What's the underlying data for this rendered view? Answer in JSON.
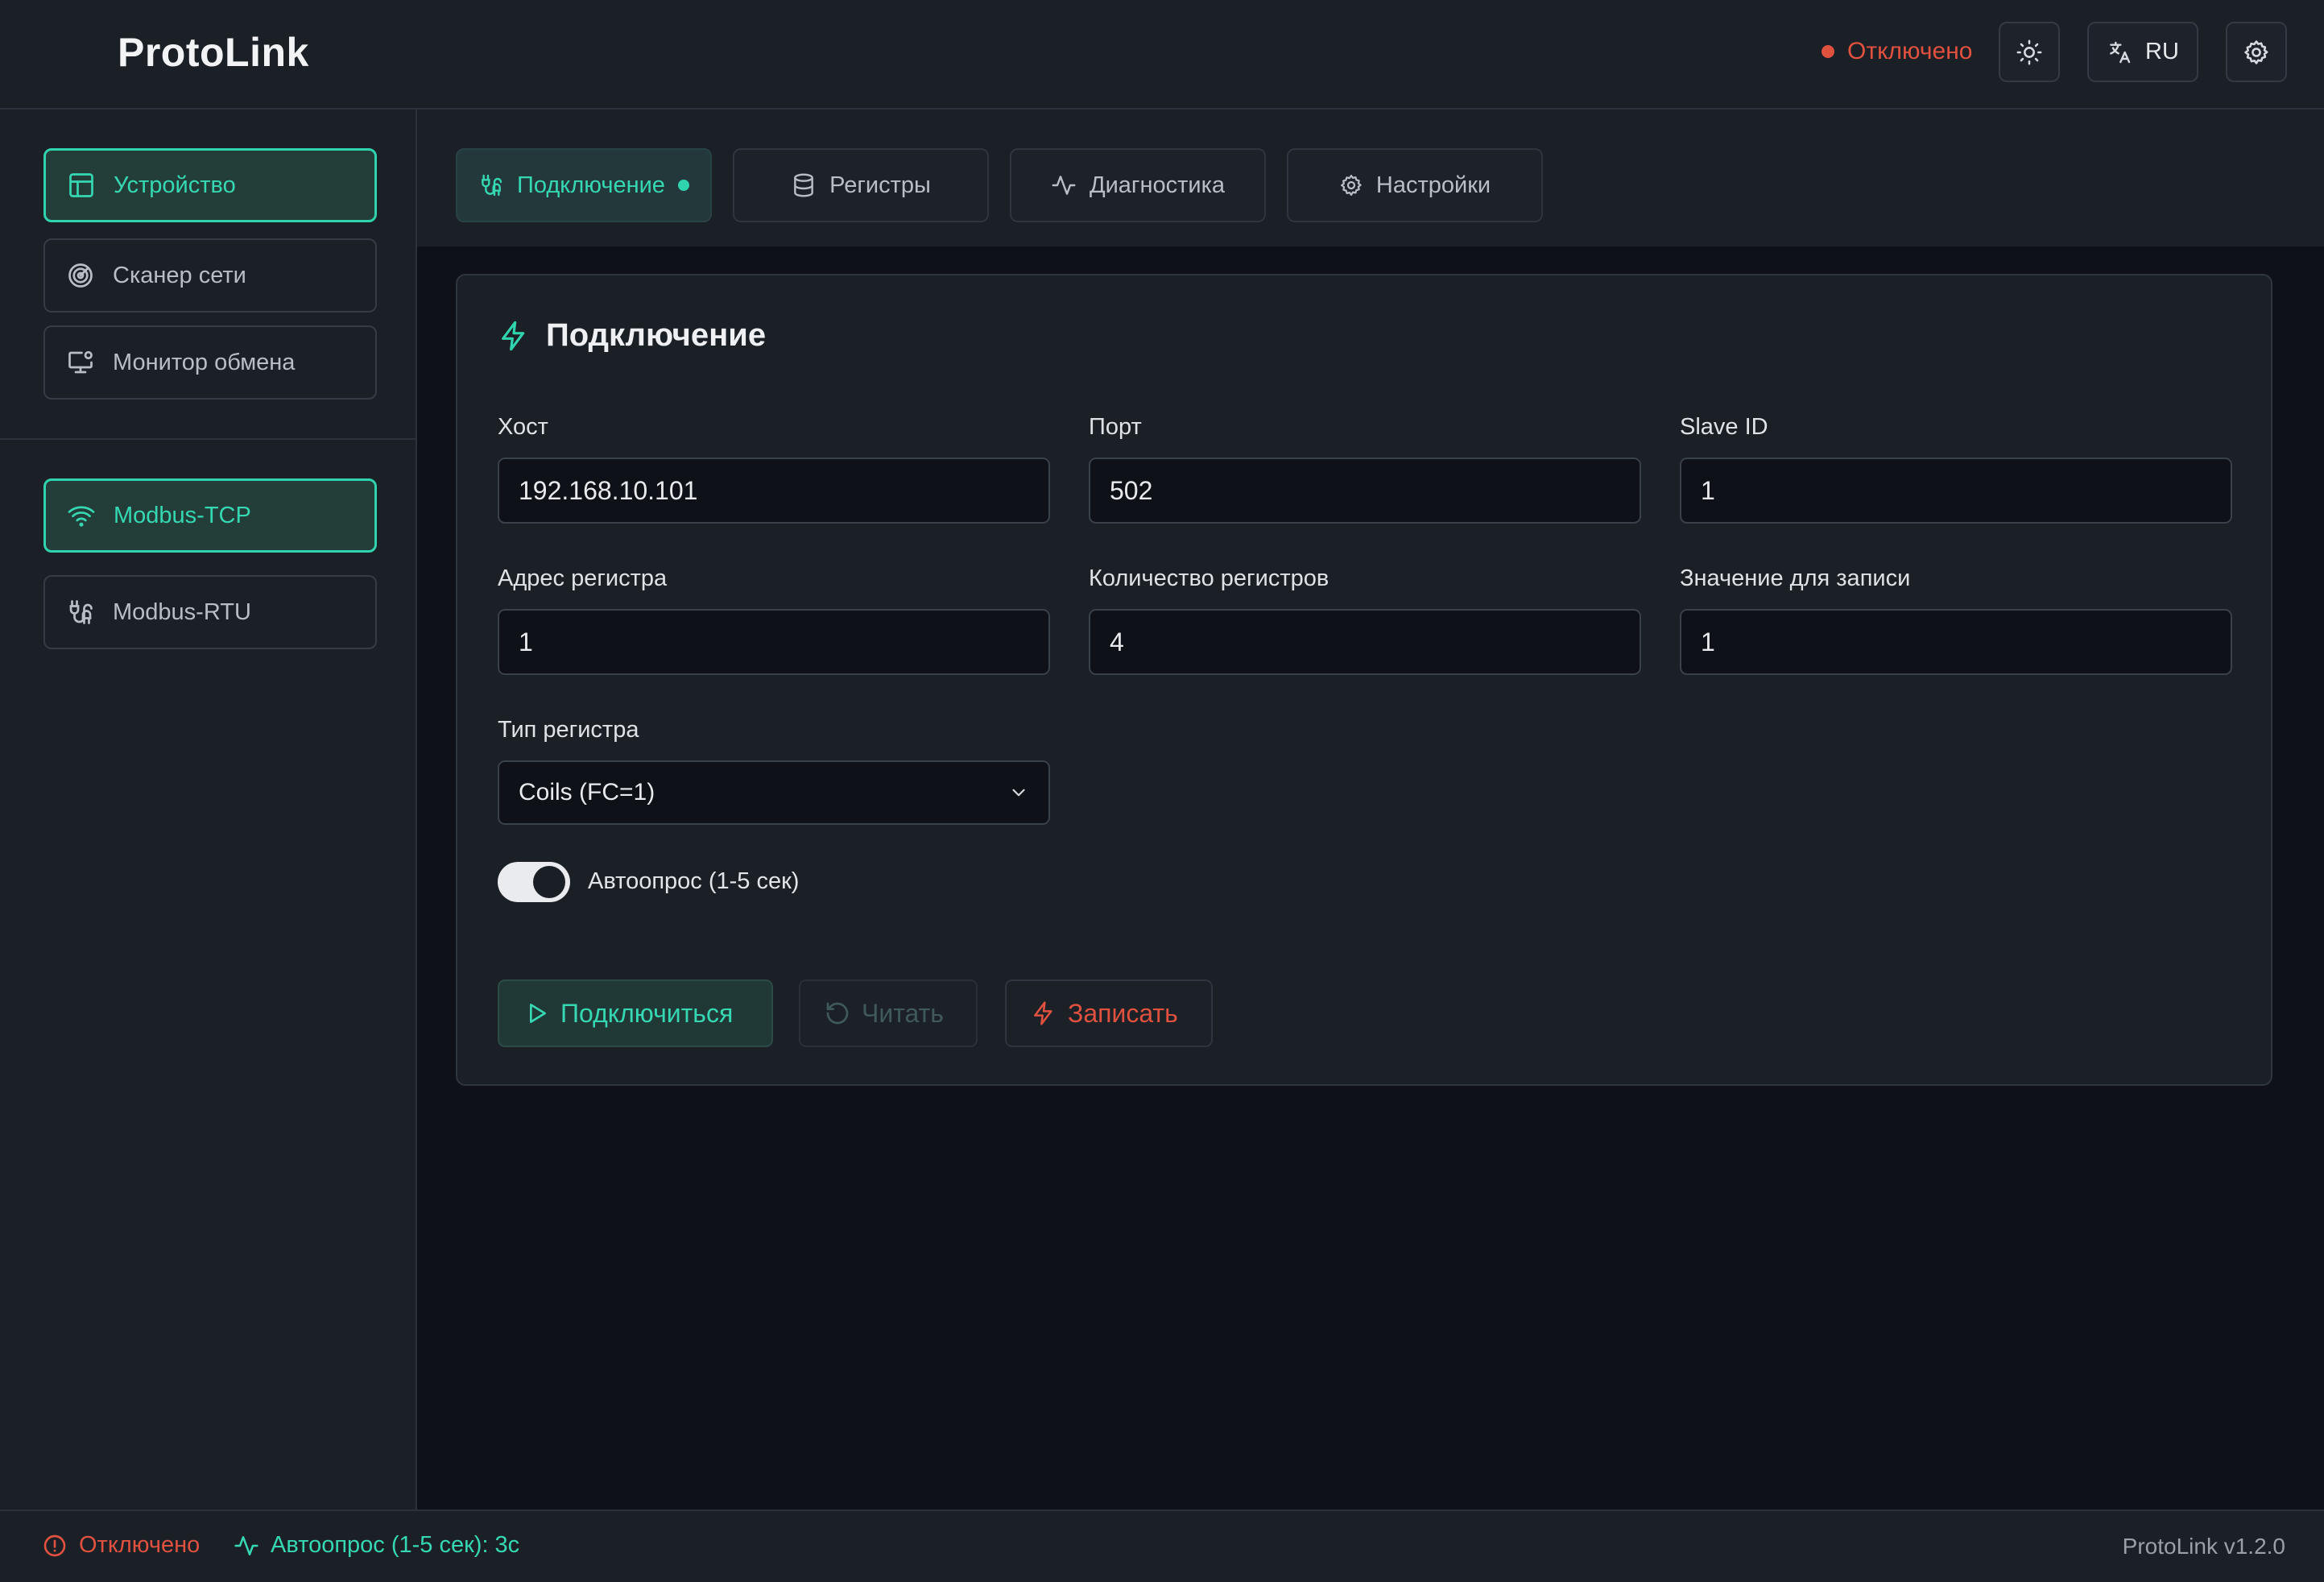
{
  "app": {
    "title": "ProtoLink"
  },
  "header": {
    "status_text": "Отключено",
    "language": "RU",
    "theme_icon": "sun-icon",
    "language_icon": "translate-icon",
    "settings_icon": "gear-icon"
  },
  "sidebar": {
    "sections": [
      {
        "label": "Устройство",
        "icon": "layout-icon",
        "active": true
      },
      {
        "label": "Сканер сети",
        "icon": "radar-icon",
        "active": false
      },
      {
        "label": "Монитор обмена",
        "icon": "monitor-icon",
        "active": false
      }
    ],
    "protocols": [
      {
        "label": "Modbus-TCP",
        "icon": "wifi-icon",
        "active": true
      },
      {
        "label": "Modbus-RTU",
        "icon": "cable-icon",
        "active": false
      }
    ]
  },
  "tabs": [
    {
      "label": "Подключение",
      "icon": "cable-icon",
      "active": true
    },
    {
      "label": "Регистры",
      "icon": "database-icon",
      "active": false
    },
    {
      "label": "Диагностика",
      "icon": "activity-icon",
      "active": false
    },
    {
      "label": "Настройки",
      "icon": "gear-icon",
      "active": false
    }
  ],
  "form": {
    "title": "Подключение",
    "host": {
      "label": "Хост",
      "value": "192.168.10.101"
    },
    "port": {
      "label": "Порт",
      "value": "502"
    },
    "slave_id": {
      "label": "Slave ID",
      "value": "1"
    },
    "register_address": {
      "label": "Адрес регистра",
      "value": "1"
    },
    "register_count": {
      "label": "Количество регистров",
      "value": "4"
    },
    "write_value": {
      "label": "Значение для записи",
      "value": "1"
    },
    "register_type": {
      "label": "Тип регистра",
      "selected": "Coils (FC=1)"
    },
    "auto_poll": {
      "label": "Автоопрос (1-5 сек)",
      "enabled": true
    },
    "buttons": {
      "connect": "Подключиться",
      "read": "Читать",
      "write": "Записать"
    }
  },
  "statusbar": {
    "connection": "Отключено",
    "auto_poll": "Автоопрос (1-5 сек): 3с",
    "version": "ProtoLink v1.2.0"
  },
  "colors": {
    "accent": "#2fd3ae",
    "danger": "#e0513f",
    "background": "#0e1218",
    "panel": "#1b1f26"
  }
}
